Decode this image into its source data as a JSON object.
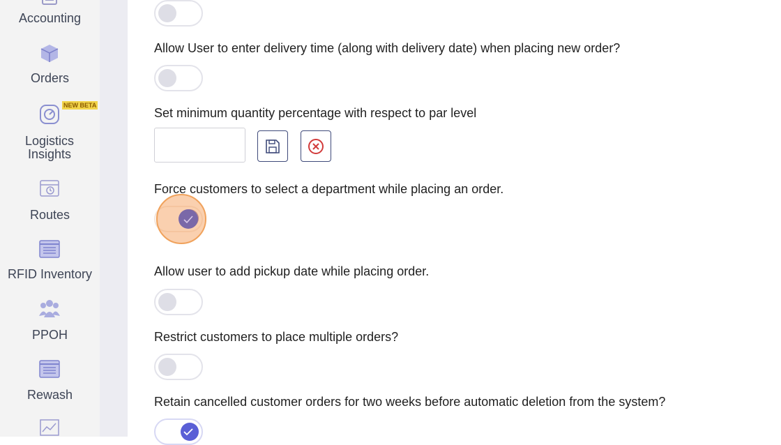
{
  "sidebar": {
    "items": [
      {
        "label": "Accounting",
        "icon": "calculator-icon"
      },
      {
        "label": "Orders",
        "icon": "box-icon"
      },
      {
        "label": "Logistics Insights",
        "icon": "gauge-icon",
        "badge": "NEW BETA"
      },
      {
        "label": "Routes",
        "icon": "calendar-clock-icon"
      },
      {
        "label": "RFID Inventory",
        "icon": "list-icon"
      },
      {
        "label": "PPOH",
        "icon": "users-icon"
      },
      {
        "label": "Rewash",
        "icon": "list-icon"
      },
      {
        "label": "",
        "icon": "chart-icon"
      }
    ]
  },
  "settings": {
    "top_toggle": {
      "state": "off"
    },
    "delivery_time": {
      "label": "Allow User to enter delivery time (along with delivery date) when placing new order?",
      "state": "off"
    },
    "min_qty": {
      "label": "Set minimum quantity percentage with respect to par level",
      "value": ""
    },
    "force_department": {
      "label": "Force customers to select a department while placing an order.",
      "state": "on"
    },
    "pickup_date": {
      "label": "Allow user to add pickup date while placing order.",
      "state": "off"
    },
    "restrict_multiple": {
      "label": "Restrict customers to place multiple orders?",
      "state": "off"
    },
    "retain_cancelled": {
      "label": "Retain cancelled customer orders for two weeks before automatic deletion from the system?",
      "state": "on"
    }
  },
  "colors": {
    "accent": "#5a5fd6",
    "nav_text": "#3d4455",
    "focus": "#f0a25c",
    "badge": "#f2d44a"
  }
}
